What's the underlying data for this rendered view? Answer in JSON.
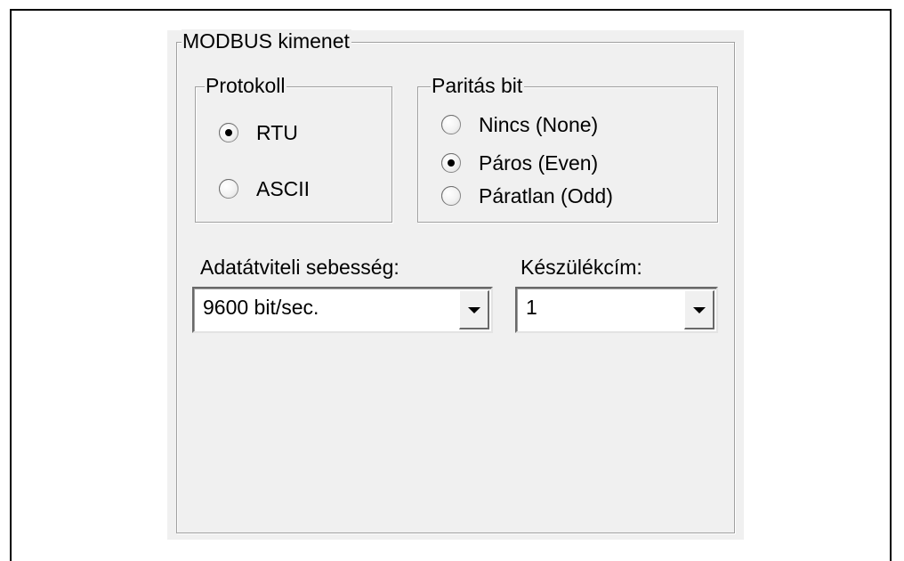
{
  "modbus_group": {
    "title": "MODBUS kimenet"
  },
  "protocol_group": {
    "title": "Protokoll",
    "options": [
      {
        "label": "RTU",
        "checked": true
      },
      {
        "label": "ASCII",
        "checked": false
      }
    ]
  },
  "parity_group": {
    "title": "Paritás bit",
    "options": [
      {
        "label": "Nincs (None)",
        "checked": false
      },
      {
        "label": "Páros (Even)",
        "checked": true
      },
      {
        "label": "Páratlan (Odd)",
        "checked": false
      }
    ]
  },
  "baud_rate": {
    "label": "Adatátviteli sebesség:",
    "value": "9600 bit/sec."
  },
  "device_address": {
    "label": "Készülékcím:",
    "value": "1"
  },
  "icons": {
    "combo_arrow": "chevron-down-icon"
  }
}
